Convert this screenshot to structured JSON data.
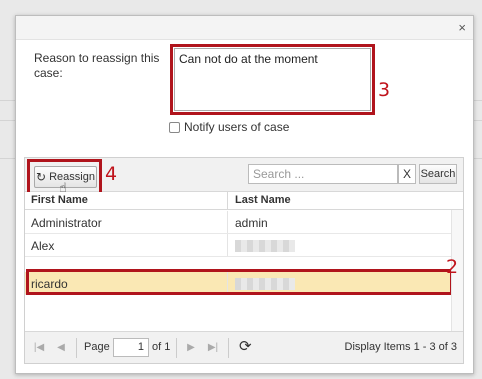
{
  "dialog": {
    "close_icon": "×",
    "reason_label": "Reason to reassign this case:",
    "reason_value": "Can not do at the moment",
    "notify_label": "Notify users of case"
  },
  "annotations": {
    "n3": "3",
    "n4": "4",
    "n2": "2"
  },
  "toolbar": {
    "reassign_label": "Reassign",
    "reassign_icon": "↻",
    "search_placeholder": "Search ...",
    "search_clear": "X",
    "search_button": "Search"
  },
  "table": {
    "headers": [
      "First Name",
      "Last Name"
    ],
    "rows": [
      {
        "first": "Administrator",
        "last": "admin"
      },
      {
        "first": "Alex",
        "last": ""
      },
      {
        "first": "ricardo",
        "last": ""
      }
    ],
    "selected_row": 2
  },
  "pager": {
    "page_label": "Page",
    "page_value": "1",
    "of_label": "of 1",
    "display_items": "Display Items 1 - 3 of 3",
    "first_icon": "|◀",
    "prev_icon": "◀",
    "next_icon": "▶",
    "last_icon": "▶|",
    "refresh_icon": "⟳"
  },
  "colors": {
    "highlight": "#b0141c",
    "selected_row": "#fae8b4"
  }
}
